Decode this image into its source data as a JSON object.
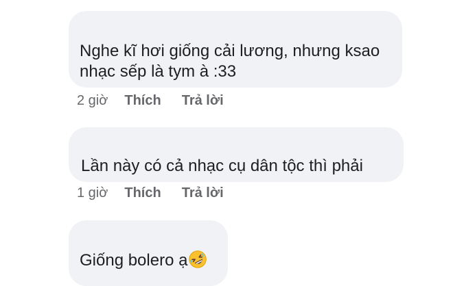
{
  "comments": [
    {
      "text_lines": [
        "Nghe kĩ hơi giống cải lương, nhưng ksao",
        "nhạc sếp là tym à :33"
      ],
      "time": "2 giờ",
      "like_label": "Thích",
      "reply_label": "Trả lời"
    },
    {
      "text_lines": [
        "Lần này có cả nhạc cụ dân tộc thì phải"
      ],
      "time": "1 giờ",
      "like_label": "Thích",
      "reply_label": "Trả lời"
    },
    {
      "text_lines": [
        "Giống bolero ạ"
      ],
      "emoji": "rolling-on-the-floor-laughing-emoji"
    }
  ],
  "colors": {
    "bubble_background": "#f0f2f5",
    "text": "#1c1e21",
    "meta_text": "#65676b",
    "emoji_face": "#fbc02d"
  }
}
